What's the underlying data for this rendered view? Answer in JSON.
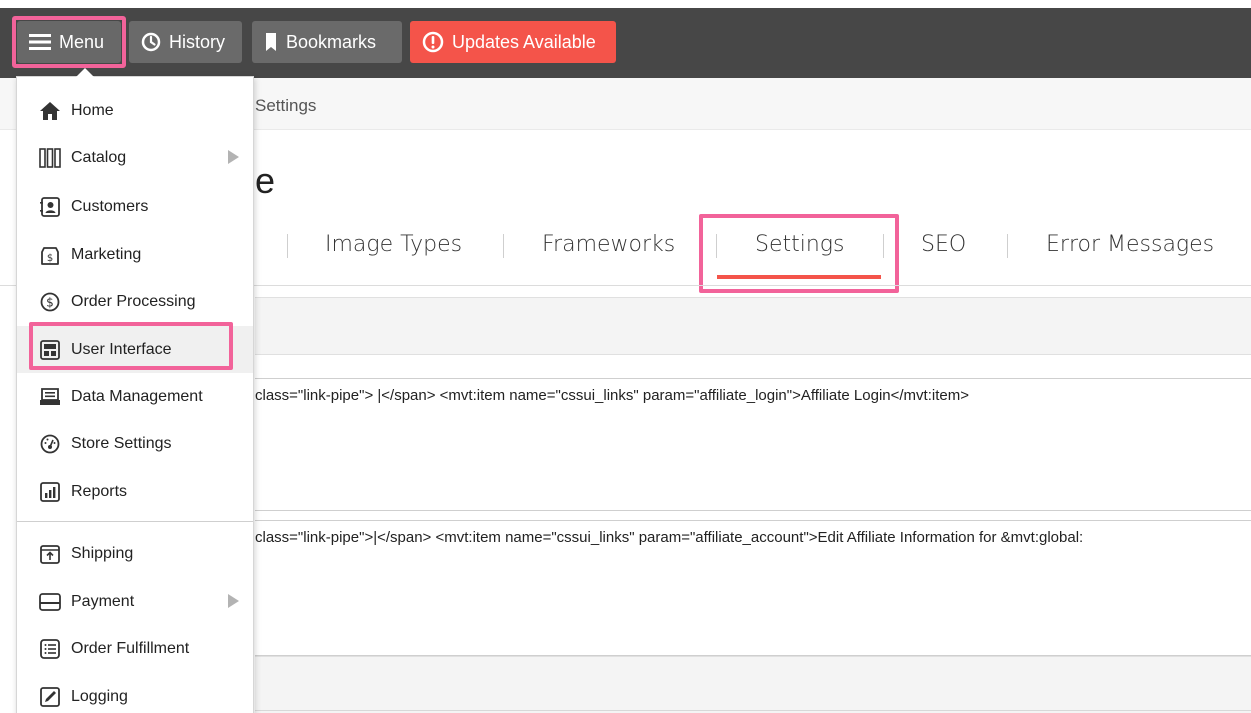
{
  "topbar": {
    "menu_label": "Menu",
    "history_label": "History",
    "bookmarks_label": "Bookmarks",
    "updates_label": "Updates Available",
    "colors": {
      "bar": "#474747",
      "button": "#6a6a6a",
      "updates": "#f4544a",
      "highlight": "#f2639a"
    }
  },
  "breadcrumb": {
    "current": "Settings"
  },
  "page": {
    "title_fragment": "e"
  },
  "tabs": [
    {
      "label": "Image Types"
    },
    {
      "label": "Frameworks"
    },
    {
      "label": "Settings",
      "active": true
    },
    {
      "label": "SEO"
    },
    {
      "label": "Error Messages"
    }
  ],
  "content": {
    "code_1": "class=\"link-pipe\"> |</span> <mvt:item name=\"cssui_links\" param=\"affiliate_login\">Affiliate Login</mvt:item>",
    "code_2": "class=\"link-pipe\">|</span> <mvt:item name=\"cssui_links\" param=\"affiliate_account\">Edit Affiliate Information for &mvt:global:"
  },
  "menu": {
    "items": [
      {
        "label": "Home",
        "icon": "home-icon"
      },
      {
        "label": "Catalog",
        "icon": "catalog-icon",
        "submenu": true
      },
      {
        "label": "Customers",
        "icon": "customers-icon"
      },
      {
        "label": "Marketing",
        "icon": "marketing-icon"
      },
      {
        "label": "Order Processing",
        "icon": "order-processing-icon"
      },
      {
        "label": "User Interface",
        "icon": "user-interface-icon",
        "active": true
      },
      {
        "label": "Data Management",
        "icon": "data-management-icon"
      },
      {
        "label": "Store Settings",
        "icon": "store-settings-icon"
      },
      {
        "label": "Reports",
        "icon": "reports-icon"
      },
      {
        "label": "Shipping",
        "icon": "shipping-icon"
      },
      {
        "label": "Payment",
        "icon": "payment-icon",
        "submenu": true
      },
      {
        "label": "Order Fulfillment",
        "icon": "order-fulfillment-icon"
      },
      {
        "label": "Logging",
        "icon": "logging-icon"
      }
    ]
  }
}
